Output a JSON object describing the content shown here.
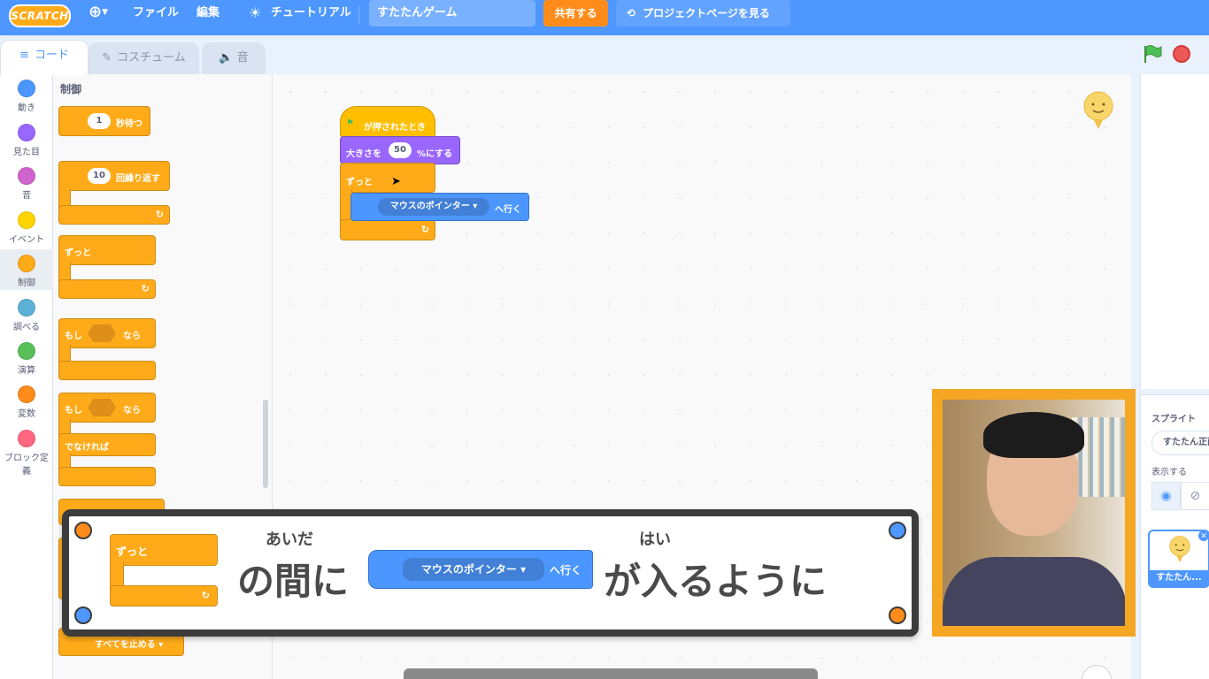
{
  "menu": {
    "logo": "SCRATCH",
    "file": "ファイル",
    "edit": "編集",
    "tutorial": "チュートリアル",
    "project_title": "すたたんゲーム",
    "share": "共有する",
    "project_page": "プロジェクトページを見る"
  },
  "tabs": {
    "code": "コード",
    "costumes": "コスチューム",
    "sounds": "音"
  },
  "categories": [
    {
      "label": "動き",
      "color": "#4c97ff"
    },
    {
      "label": "見た目",
      "color": "#9966ff"
    },
    {
      "label": "音",
      "color": "#cf63cf"
    },
    {
      "label": "イベント",
      "color": "#ffd500"
    },
    {
      "label": "制御",
      "color": "#ffab19"
    },
    {
      "label": "調べる",
      "color": "#5cb1d6"
    },
    {
      "label": "演算",
      "color": "#59c059"
    },
    {
      "label": "変数",
      "color": "#ff8c1a"
    },
    {
      "label": "ブロック定義",
      "color": "#ff6680"
    }
  ],
  "palette": {
    "title": "制御",
    "wait": {
      "value": "1",
      "label": "秒待つ"
    },
    "repeat": {
      "value": "10",
      "label": "回繰り返す"
    },
    "forever": "ずっと",
    "if": {
      "a": "もし",
      "b": "なら"
    },
    "ifelse": {
      "a": "もし",
      "b": "なら",
      "else": "でなければ"
    },
    "stop": "すべてを止める ▾"
  },
  "script": {
    "hat": "が押されたとき",
    "size_a": "大きさを",
    "size_value": "50",
    "size_b": "%にする",
    "forever": "ずっと",
    "goto_menu": "マウスのポインター",
    "goto_label": "へ行く"
  },
  "sprite_pane": {
    "label": "スプライト",
    "name_value": "すたたん正面",
    "show": "表示する",
    "card_name": "すたたん..."
  },
  "caption": {
    "block_forever": "ずっと",
    "text1": "の間に",
    "ruby1": "あいだ",
    "goto_menu": "マウスのポインター",
    "goto_label": "へ行く",
    "text2": "が入るように",
    "ruby2": "はい"
  }
}
